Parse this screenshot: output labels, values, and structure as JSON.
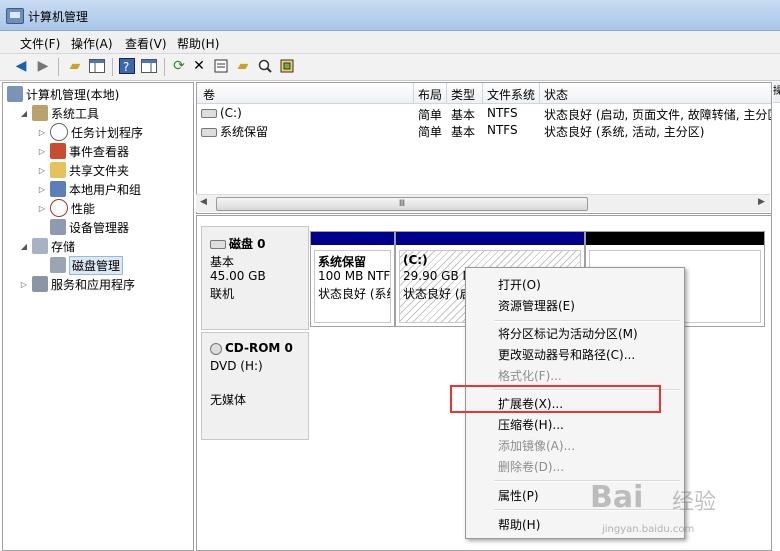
{
  "window": {
    "title": "计算机管理"
  },
  "menu": [
    "文件(F)",
    "操作(A)",
    "查看(V)",
    "帮助(H)"
  ],
  "toolbar": {
    "icons": [
      "back-arrow-icon",
      "forward-arrow-icon",
      "up-folder-icon",
      "show-hide-tree-icon",
      "help-icon",
      "properties-pane-icon",
      "refresh-icon",
      "delete-icon",
      "properties-icon",
      "open-folder-icon",
      "search-icon",
      "export-icon"
    ]
  },
  "tree": {
    "root": "计算机管理(本地)",
    "system_tools": "系统工具",
    "task_scheduler": "任务计划程序",
    "event_viewer": "事件查看器",
    "shared_folders": "共享文件夹",
    "local_users": "本地用户和组",
    "performance": "性能",
    "device_manager": "设备管理器",
    "storage": "存储",
    "disk_management": "磁盘管理",
    "services_apps": "服务和应用程序"
  },
  "volume_table": {
    "columns": [
      "卷",
      "布局",
      "类型",
      "文件系统",
      "状态"
    ],
    "rows": [
      {
        "volume": "(C:)",
        "layout": "简单",
        "type": "基本",
        "fs": "NTFS",
        "status": "状态良好 (启动, 页面文件, 故障转储, 主分区)"
      },
      {
        "volume": "系统保留",
        "layout": "简单",
        "type": "基本",
        "fs": "NTFS",
        "status": "状态良好 (系统, 活动, 主分区)"
      }
    ],
    "scroll_thumb": "Ⅲ"
  },
  "actions_header": "操",
  "disk0": {
    "name": "磁盘 0",
    "type": "基本",
    "size": "45.00 GB",
    "state": "联机",
    "partitions": [
      {
        "name": "系统保留",
        "size": "100 MB NTF",
        "status": "状态良好 (系统"
      },
      {
        "name": "(C:)",
        "size": "29.90 GB N",
        "status": "状态良好 (启"
      }
    ]
  },
  "cdrom0": {
    "name": "CD-ROM 0",
    "drive": "DVD (H:)",
    "media": "无媒体"
  },
  "context_menu": {
    "open": "打开(O)",
    "explorer": "资源管理器(E)",
    "mark_active": "将分区标记为活动分区(M)",
    "change_letter": "更改驱动器号和路径(C)...",
    "format": "格式化(F)...",
    "extend": "扩展卷(X)...",
    "shrink": "压缩卷(H)...",
    "add_mirror": "添加镜像(A)...",
    "delete": "删除卷(D)...",
    "properties": "属性(P)",
    "help": "帮助(H)"
  },
  "watermark": {
    "logo": "Bai",
    "text": "经验",
    "url": "jingyan.baidu.com"
  },
  "colors": {
    "primary_partition": "#00008b",
    "unallocated": "#000000",
    "highlight": "#e33333"
  }
}
